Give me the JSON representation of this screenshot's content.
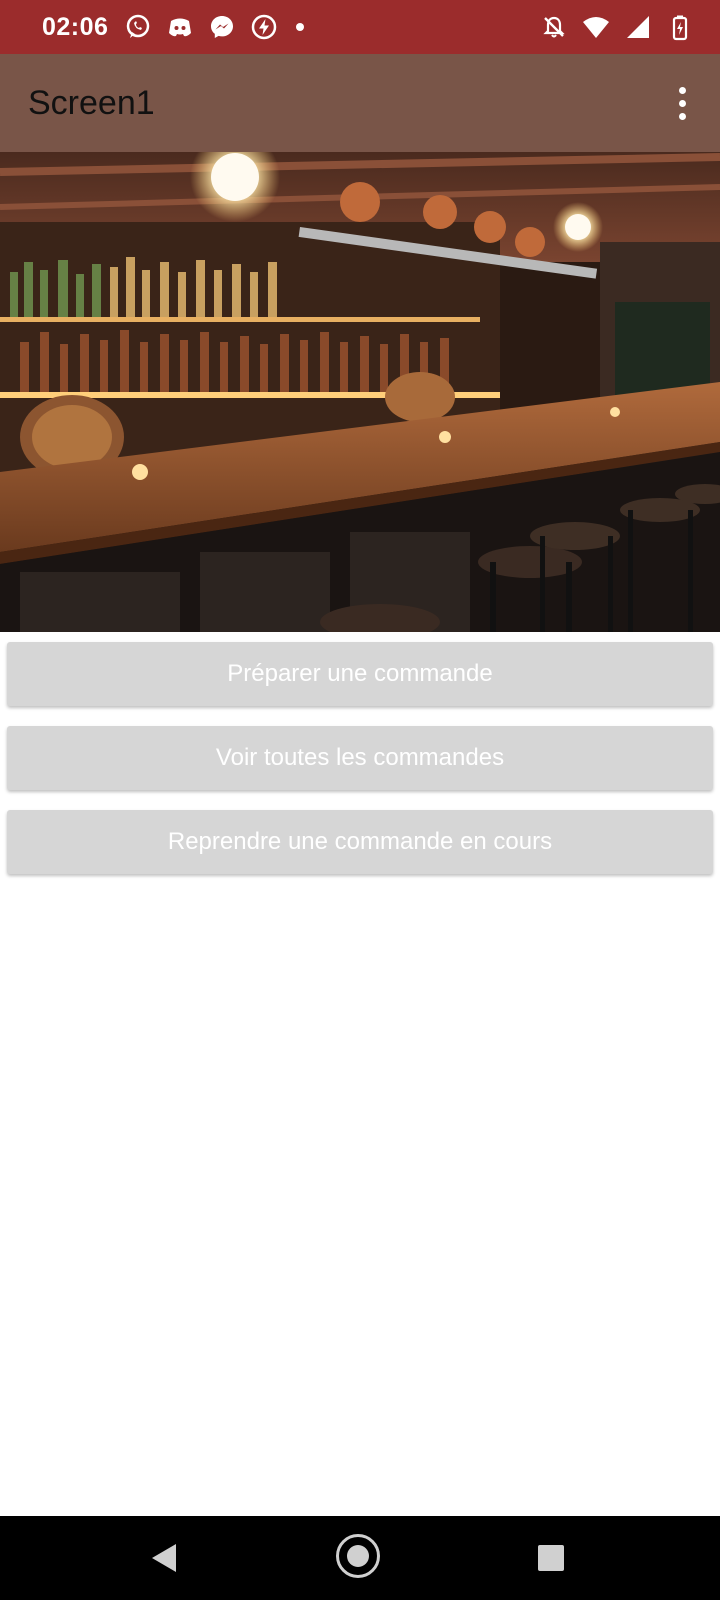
{
  "status_bar": {
    "time": "02:06",
    "left_icons": [
      "whatsapp-icon",
      "discord-icon",
      "messenger-icon",
      "flash-icon",
      "notification-dot"
    ],
    "right_icons": [
      "notifications-off-icon",
      "wifi-icon",
      "signal-icon",
      "battery-charging-icon"
    ],
    "color": "#9b2c2c"
  },
  "app_bar": {
    "title": "Screen1",
    "menu_icon": "more-vert-icon",
    "color": "#795548"
  },
  "hero_image": {
    "subject": "bar-interior-photo"
  },
  "buttons": [
    {
      "label": "Préparer une commande"
    },
    {
      "label": "Voir toutes les commandes"
    },
    {
      "label": "Reprendre une commande en cours"
    }
  ],
  "button_style": {
    "background": "#d6d6d6",
    "text_color": "#ffffff"
  },
  "nav_bar": {
    "icons": [
      "back-icon",
      "home-icon",
      "recents-icon"
    ]
  }
}
